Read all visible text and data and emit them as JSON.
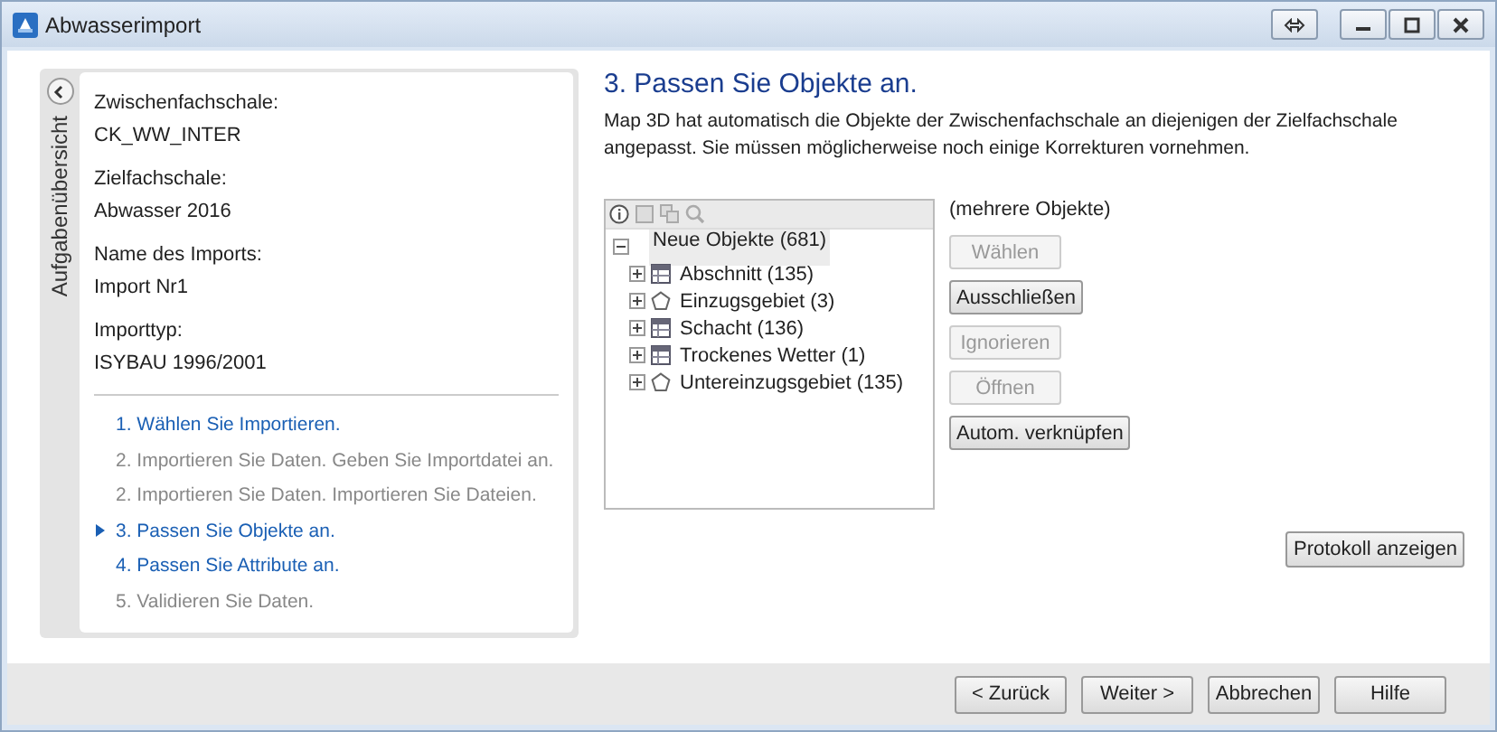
{
  "window": {
    "title": "Abwasserimport"
  },
  "task_panel": {
    "tab_label": "Aufgabenübersicht",
    "fields": [
      {
        "label": "Zwischenfachschale:",
        "value": "CK_WW_INTER"
      },
      {
        "label": "Zielfachschale:",
        "value": "Abwasser 2016"
      },
      {
        "label": "Name des Imports:",
        "value": "Import Nr1"
      },
      {
        "label": "Importtyp:",
        "value": "ISYBAU 1996/2001"
      }
    ],
    "steps": [
      {
        "label": "1. Wählen Sie Importieren.",
        "enabled": true,
        "selected": false
      },
      {
        "label": "2. Importieren Sie Daten. Geben Sie Importdatei an.",
        "enabled": false,
        "selected": false
      },
      {
        "label": "2. Importieren Sie Daten. Importieren Sie Dateien.",
        "enabled": false,
        "selected": false
      },
      {
        "label": "3. Passen Sie Objekte an.",
        "enabled": true,
        "selected": true
      },
      {
        "label": "4. Passen Sie Attribute an.",
        "enabled": true,
        "selected": false
      },
      {
        "label": "5. Validieren Sie Daten.",
        "enabled": false,
        "selected": false
      }
    ]
  },
  "content": {
    "heading": "3. Passen Sie Objekte an.",
    "description": "Map 3D hat automatisch die Objekte der Zwischenfachschale an diejenigen der Zielfachschale angepasst. Sie müssen möglicherweise noch einige Korrekturen vornehmen.",
    "tree": {
      "label": "Neue Objekte (681)",
      "expanded": true,
      "selected": true,
      "children": [
        {
          "label": "Abschnitt (135)",
          "kind": "table",
          "expanded": false,
          "selected": false
        },
        {
          "label": "Einzugsgebiet (3)",
          "kind": "polygon",
          "expanded": false,
          "selected": false
        },
        {
          "label": "Schacht (136)",
          "kind": "table",
          "expanded": false,
          "selected": false
        },
        {
          "label": "Trockenes Wetter (1)",
          "kind": "table",
          "expanded": false,
          "selected": false
        },
        {
          "label": "Untereinzugsgebiet (135)",
          "kind": "polygon",
          "expanded": false,
          "selected": false
        }
      ]
    },
    "selection_label": "(mehrere Objekte)",
    "actions": [
      {
        "label": "Wählen",
        "disabled": true
      },
      {
        "label": "Ausschließen",
        "disabled": false
      },
      {
        "label": "Ignorieren",
        "disabled": true
      },
      {
        "label": "Öffnen",
        "disabled": true
      },
      {
        "label": "Autom. verknüpfen",
        "disabled": false
      }
    ],
    "log_button": "Protokoll anzeigen"
  },
  "footer_buttons": [
    "< Zurück",
    "Weiter >",
    "Abbrechen",
    "Hilfe"
  ]
}
